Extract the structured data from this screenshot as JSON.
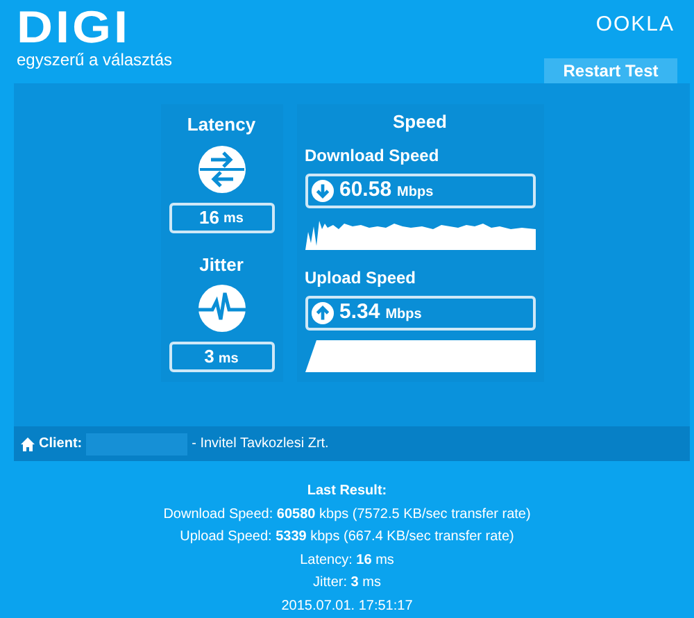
{
  "logo": {
    "name": "DIGI",
    "slogan": "egyszerű a választás"
  },
  "brand": "OOKLA",
  "restart_button": {
    "label": "Restart Test"
  },
  "latency": {
    "title": "Latency",
    "value": "16",
    "unit": "ms"
  },
  "jitter": {
    "title": "Jitter",
    "value": "3",
    "unit": "ms"
  },
  "speed": {
    "title": "Speed",
    "tests": [
      {
        "kind": "download",
        "title": "Download Speed",
        "value": "60.58",
        "unit": "Mbps"
      },
      {
        "kind": "upload",
        "title": "Upload Speed",
        "value": "5.34",
        "unit": "Mbps"
      }
    ]
  },
  "client": {
    "label": "Client:",
    "isp": "- Invitel Tavkozlesi Zrt."
  },
  "last_result": {
    "title": "Last Result:",
    "lines": [
      "Download Speed: **60580** kbps (7572.5 KB/sec transfer rate)",
      "Upload Speed: **5339** kbps (667.4 KB/sec transfer rate)",
      "Latency: **16** ms",
      "Jitter: **3** ms",
      "2015.07.01. 17:51:17"
    ]
  }
}
